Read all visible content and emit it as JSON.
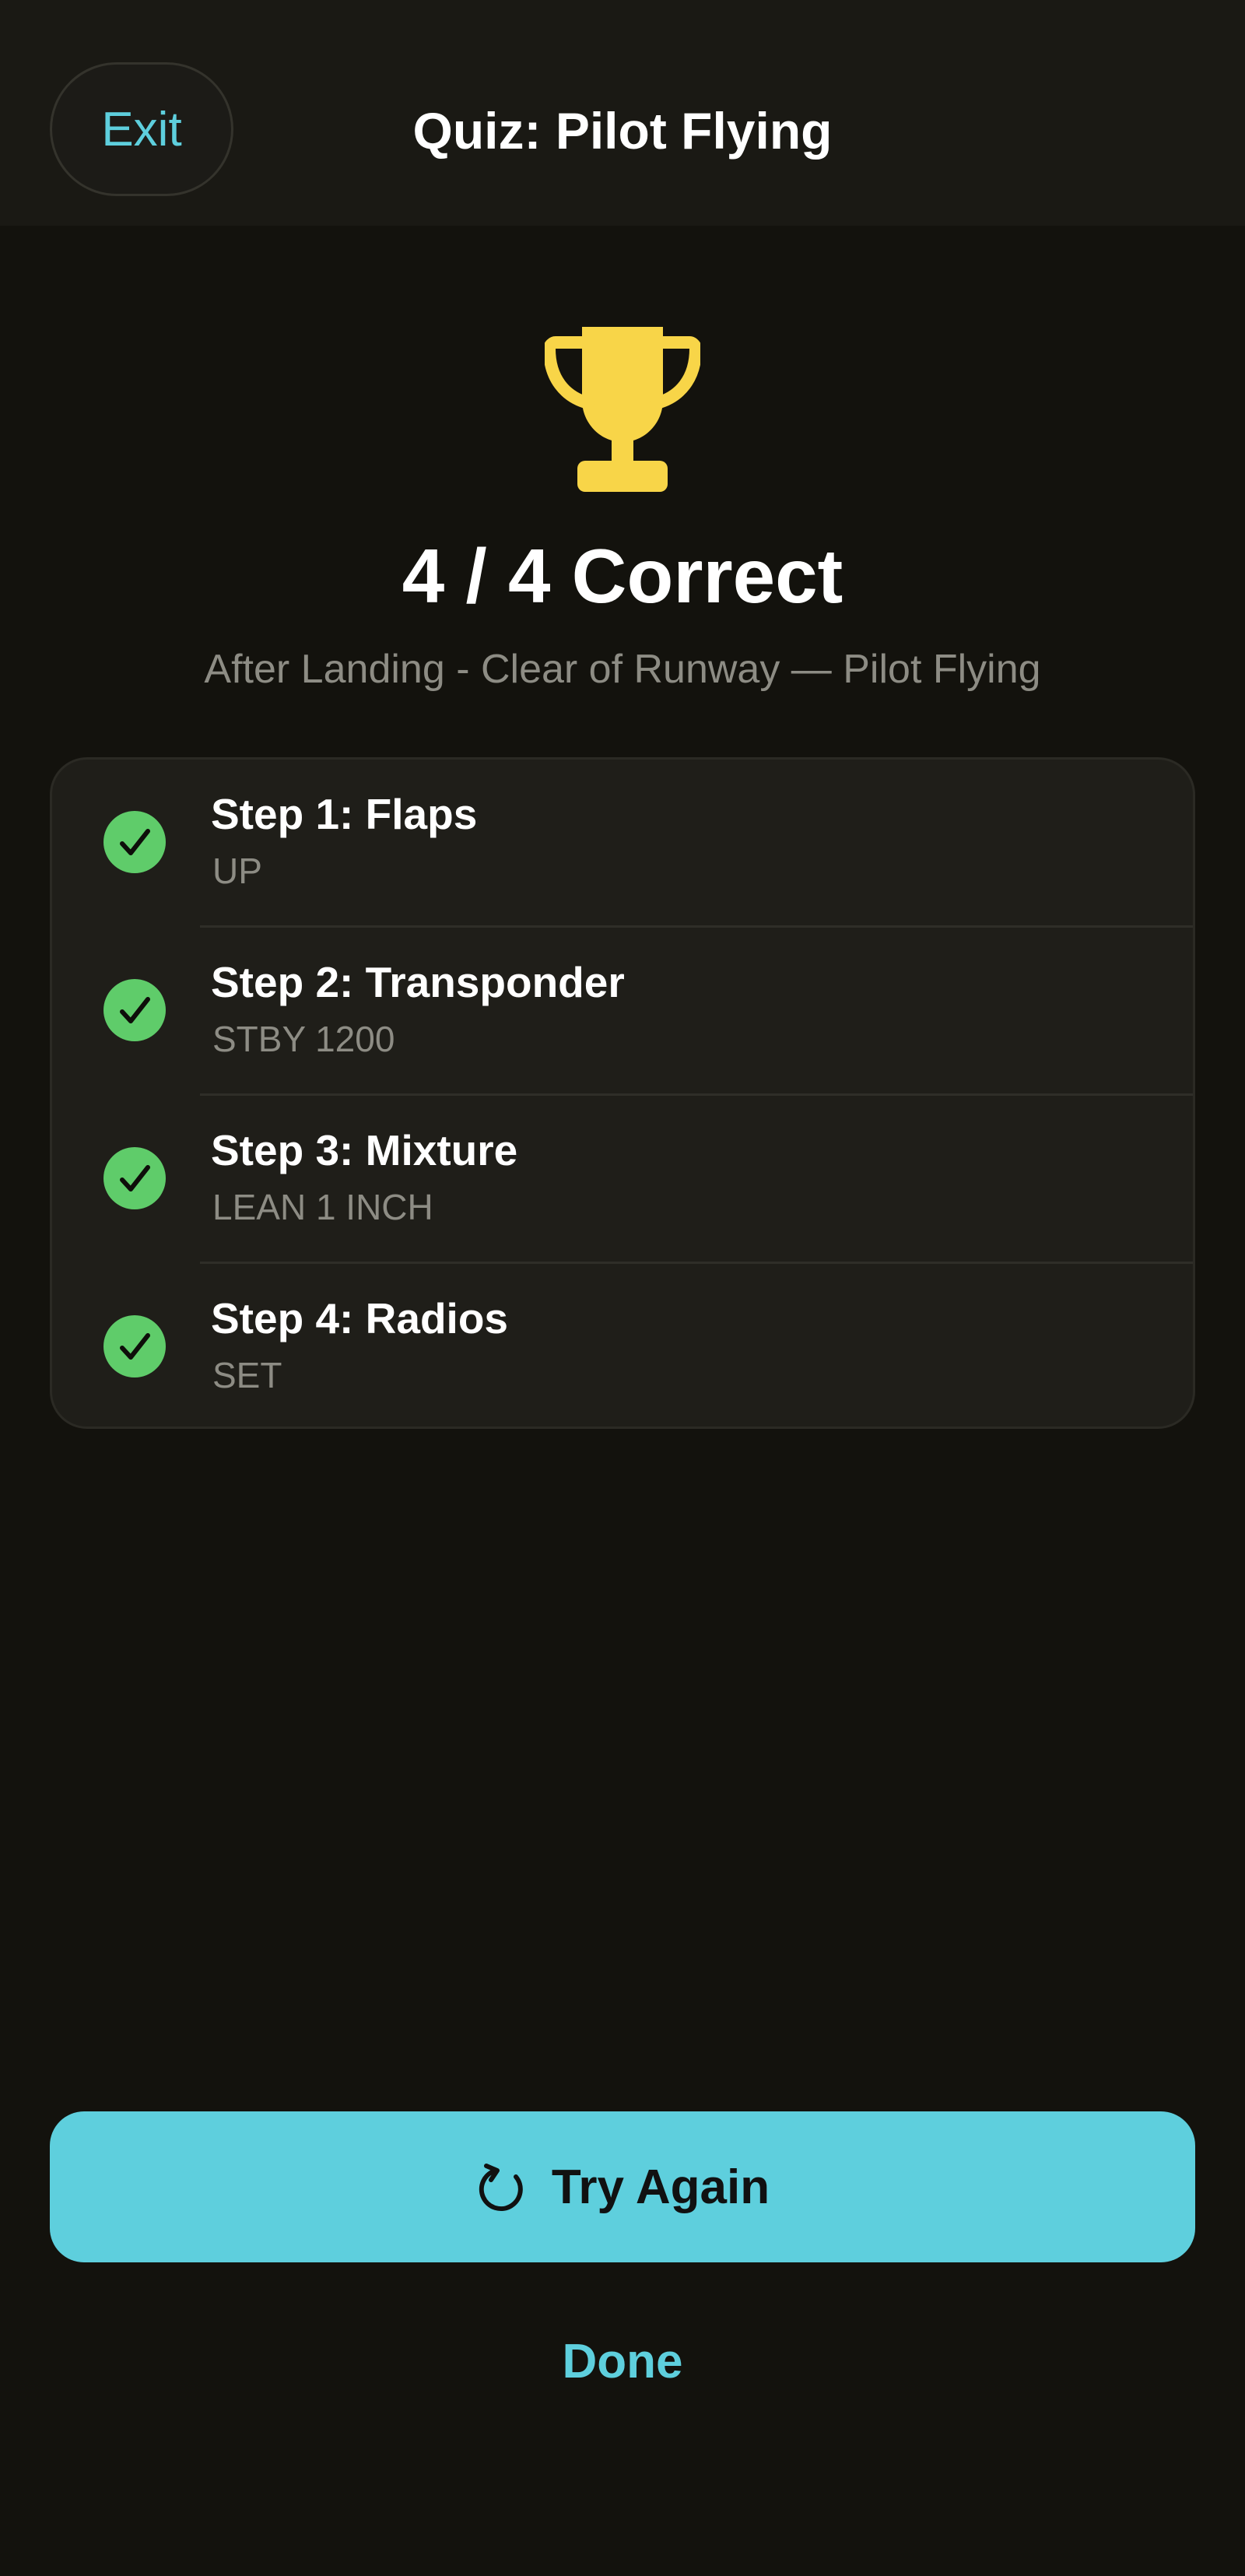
{
  "header": {
    "exit_label": "Exit",
    "title": "Quiz: Pilot Flying"
  },
  "result": {
    "icon": "trophy-icon",
    "score_text": "4 / 4 Correct",
    "correct": 4,
    "total": 4,
    "subtitle": "After Landing - Clear of Runway — Pilot Flying"
  },
  "steps": [
    {
      "label": "Step 1: Flaps",
      "value": "UP",
      "status": "correct"
    },
    {
      "label": "Step 2: Transponder",
      "value": "STBY 1200",
      "status": "correct"
    },
    {
      "label": "Step 3: Mixture",
      "value": "LEAN 1 INCH",
      "status": "correct"
    },
    {
      "label": "Step 4: Radios",
      "value": "SET",
      "status": "correct"
    }
  ],
  "actions": {
    "try_again_label": "Try Again",
    "try_again_icon": "retry-icon",
    "done_label": "Done"
  },
  "colors": {
    "background": "#13120d",
    "accent": "#5ecfdd",
    "success": "#5fcc6a",
    "trophy": "#f8d548",
    "muted_text": "#8d8c84"
  }
}
